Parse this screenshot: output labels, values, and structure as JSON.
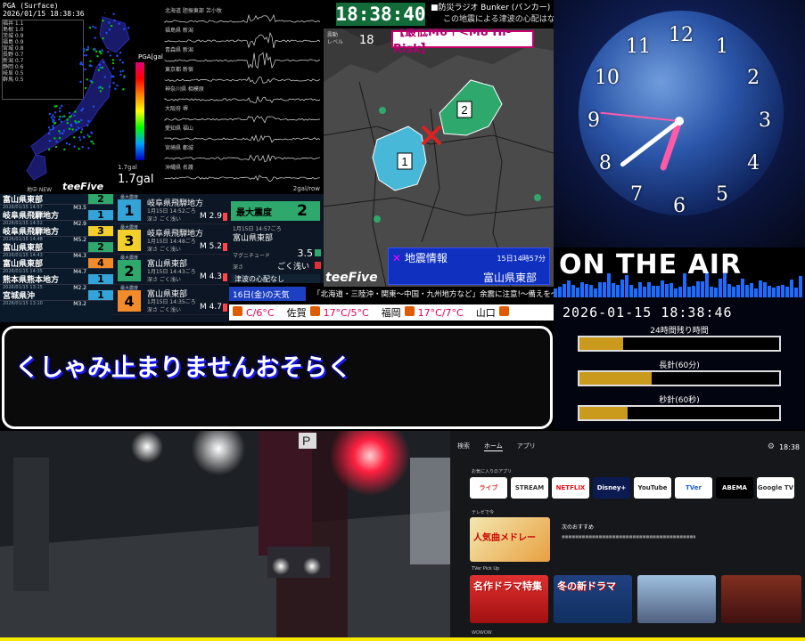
{
  "pga": {
    "title": "PGA (Surface)",
    "time": "2026/01/15 18:38:36",
    "scale_label": "PGA[gal]",
    "gal_small": "1.7gal",
    "gal_value": "1.7gal",
    "footer": "地中 NEW",
    "logo": "teeFive",
    "stations": [
      "福井 1.1",
      "島根 1.0",
      "茨城 0.9",
      "福島 0.9",
      "宮城 0.8",
      "長野 0.7",
      "新潟 0.7",
      "静岡 0.6",
      "岐阜 0.5",
      "群馬 0.5"
    ]
  },
  "seismograph": {
    "rows": [
      "北海道 胆振東部 苫小牧",
      "福島県 新潟",
      "青森県 新潟",
      "東京都 新宿",
      "神奈川県 相模原",
      "大阪府 堺",
      "愛知県 福山",
      "宮崎県 都城",
      "沖縄県 名護"
    ],
    "scale": "2gal/row"
  },
  "quake_list": [
    {
      "place": "富山県東部",
      "intensity": "2",
      "color": "#2ea86d",
      "date": "2026/01/15 14:57",
      "mag": "M3.5"
    },
    {
      "place": "岐阜県飛騨地方",
      "intensity": "1",
      "color": "#34a3d8",
      "date": "2026/01/15 14:52",
      "mag": "M2.9"
    },
    {
      "place": "岐阜県飛騨地方",
      "intensity": "3",
      "color": "#f2cf2b",
      "date": "2026/01/15 14:48",
      "mag": "M5.2"
    },
    {
      "place": "富山県東部",
      "intensity": "2",
      "color": "#2ea86d",
      "date": "2026/01/15 14:43",
      "mag": "M4.3"
    },
    {
      "place": "富山県東部",
      "intensity": "4",
      "color": "#f28b2b",
      "date": "2026/01/15 14:35",
      "mag": "M4.7"
    },
    {
      "place": "熊本県熊本地方",
      "intensity": "1",
      "color": "#34a3d8",
      "date": "2026/01/15 13:15",
      "mag": "M2.2"
    },
    {
      "place": "宮城県沖",
      "intensity": "1",
      "color": "#34a3d8",
      "date": "2026/01/15 13:10",
      "mag": "M3.2"
    }
  ],
  "quake_detail": [
    {
      "badge_top": "最大震度",
      "intensity": "1",
      "color": "#34a3d8",
      "place": "岐阜県飛騨地方",
      "date": "1月15日 14:52ごろ",
      "depth": "深さ ごく浅い",
      "mag": "M 2.9"
    },
    {
      "badge_top": "最大震度",
      "intensity": "3",
      "color": "#f2cf2b",
      "place": "岐阜県飛騨地方",
      "date": "1月15日 14:48ごろ",
      "depth": "深さ ごく浅い",
      "mag": "M 5.2"
    },
    {
      "badge_top": "最大震度",
      "intensity": "2",
      "color": "#2ea86d",
      "place": "富山県東部",
      "date": "1月15日 14:43ごろ",
      "depth": "深さ ごく浅い",
      "mag": "M 4.3"
    },
    {
      "badge_top": "最大震度",
      "intensity": "4",
      "color": "#f28b2b",
      "place": "富山県東部",
      "date": "1月15日 14:35ごろ",
      "depth": "深さ ごく浅い",
      "mag": "M 4.7"
    }
  ],
  "max_intensity": {
    "label": "最大震度",
    "value": "2",
    "date": "1月15日 14:57ごろ",
    "place": "富山県東部",
    "mag_label": "マグニチュード",
    "mag": "3.5",
    "depth_label": "深さ",
    "depth": "ごく浅い",
    "note": "津波の心配なし"
  },
  "top_clock": {
    "time": "18:38:40",
    "bunker": "■防災ラジオ Bunker (バンカー)",
    "tsunami": "この地震による津波の心配はなし"
  },
  "map": {
    "shindo_label": "震動\nレベル",
    "shindo_value": "18",
    "risk": "【最低M6＋<M8 Hi-Risk】",
    "info_title": "地震情報",
    "info_date": "15日14時57分",
    "info_place": "富山県東部",
    "region_labels": [
      "1",
      "2"
    ],
    "logo": "teeFive"
  },
  "weather": {
    "date": "16日(金)の天気",
    "warning": "「北海道・三陸沖・関東～中国・九州地方など」余震に注意!～備えを～",
    "cities": [
      {
        "name": "",
        "temp": "C/6°C"
      },
      {
        "name": "佐賀",
        "temp": "17°C/5°C"
      },
      {
        "name": "福岡",
        "temp": "17°C/7°C"
      },
      {
        "name": "山口",
        "temp": ""
      }
    ]
  },
  "message": {
    "text": "くしゃみ止まりませんおそらく"
  },
  "analog_clock": {
    "numbers": [
      "12",
      "1",
      "2",
      "3",
      "4",
      "5",
      "6",
      "7",
      "8",
      "9",
      "10",
      "11"
    ],
    "hour": 18,
    "minute": 38,
    "second": 46
  },
  "onair": {
    "text": "ON THE AIR",
    "bar_color": "#1e6cff"
  },
  "remaining": {
    "datetime": "2026-01-15 18:38:46",
    "labels": [
      "24時間残り時間",
      "長針(60分)",
      "秒針(60秒)"
    ],
    "fractions": [
      0.22,
      0.36,
      0.24
    ]
  },
  "tv": {
    "nav": [
      "検索",
      "ホーム",
      "アプリ"
    ],
    "time": "18:38",
    "section_favorites": "お気に入りのアプリ",
    "section_tvnow": "テレビで今",
    "section_recommend": "TVer Pick Up",
    "recommend_title": "次のおすすめ",
    "apps": [
      {
        "label": "ライブ",
        "bg": "#ffffff",
        "fg": "#d33"
      },
      {
        "label": "STREAM",
        "bg": "#ffffff",
        "fg": "#333"
      },
      {
        "label": "NETFLIX",
        "bg": "#ffffff",
        "fg": "#e50914"
      },
      {
        "label": "Disney+",
        "bg": "#0b1b52",
        "fg": "#fff"
      },
      {
        "label": "YouTube",
        "bg": "#ffffff",
        "fg": "#222"
      },
      {
        "label": "TVer",
        "bg": "#fff",
        "fg": "#2060d0"
      },
      {
        "label": "ABEMA",
        "bg": "#000",
        "fg": "#fff"
      },
      {
        "label": "Google TV",
        "bg": "#fff",
        "fg": "#333"
      }
    ],
    "featured": "人気曲メドレー",
    "tiles": [
      "名作ドラマ特集",
      "冬の新ドラマ",
      "",
      ""
    ],
    "footer": "WOWOW"
  },
  "colors": {
    "accent_yellow": "#f6e800",
    "map_region": "#47b8d8",
    "epicenter": "#e02020"
  }
}
